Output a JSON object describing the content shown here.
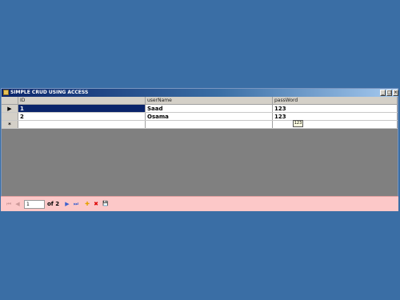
{
  "window": {
    "title": "SIMPLE CRUD USING ACCESS",
    "minimize": "_",
    "maximize": "□",
    "close": "×"
  },
  "grid": {
    "columns": [
      "ID",
      "userName",
      "passWord"
    ],
    "rows": [
      {
        "marker": "▶",
        "id": "1",
        "userName": "Saad",
        "passWord": "123"
      },
      {
        "marker": "",
        "id": "2",
        "userName": "Osama",
        "passWord": "123"
      }
    ],
    "new_row_marker": "*",
    "tooltip": "123"
  },
  "navigator": {
    "position": "1",
    "count_text": "of 2",
    "icons": {
      "first": "⏮",
      "prev": "◀",
      "next": "▶",
      "last": "⏭",
      "add": "✚",
      "delete": "✖",
      "save": "💾"
    }
  },
  "colors": {
    "desktop": "#3a6ea5",
    "titlebar": "#0a246a",
    "selected_cell": "#0a246a",
    "grid_empty": "#808080",
    "navigator": "#fcc8c8"
  }
}
